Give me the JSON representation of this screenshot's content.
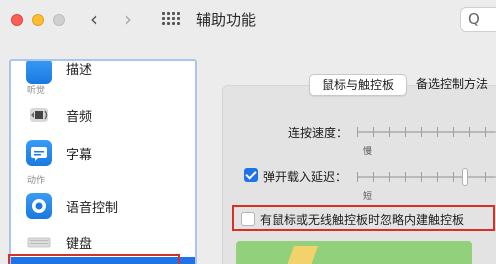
{
  "window": {
    "title": "辅助功能",
    "search_glyph": "Q"
  },
  "sidebar": {
    "partial_top_label": "描述",
    "section_hearing": "听觉",
    "items": [
      {
        "label": "音频",
        "icon": "speaker-icon"
      },
      {
        "label": "字幕",
        "icon": "captions-icon"
      }
    ],
    "section_motor": "动作",
    "items_motor": [
      {
        "label": "语音控制",
        "icon": "voice-control-icon"
      },
      {
        "label": "键盘",
        "icon": "keyboard-icon"
      }
    ]
  },
  "main": {
    "tabs": [
      {
        "label": "鼠标与触控板",
        "active": true
      },
      {
        "label": "备选控制方法",
        "active": false
      }
    ],
    "double_click_speed": {
      "label": "连按速度：",
      "slow_label": "慢"
    },
    "spring_loading": {
      "label": "弹开载入延迟：",
      "checked": true,
      "short_label": "短"
    },
    "ignore_trackpad": {
      "label": "有鼠标或无线触控板时忽略内建触控板",
      "checked": false
    }
  },
  "colors": {
    "accent": "#1e73e8",
    "highlight_box": "#d93025"
  }
}
